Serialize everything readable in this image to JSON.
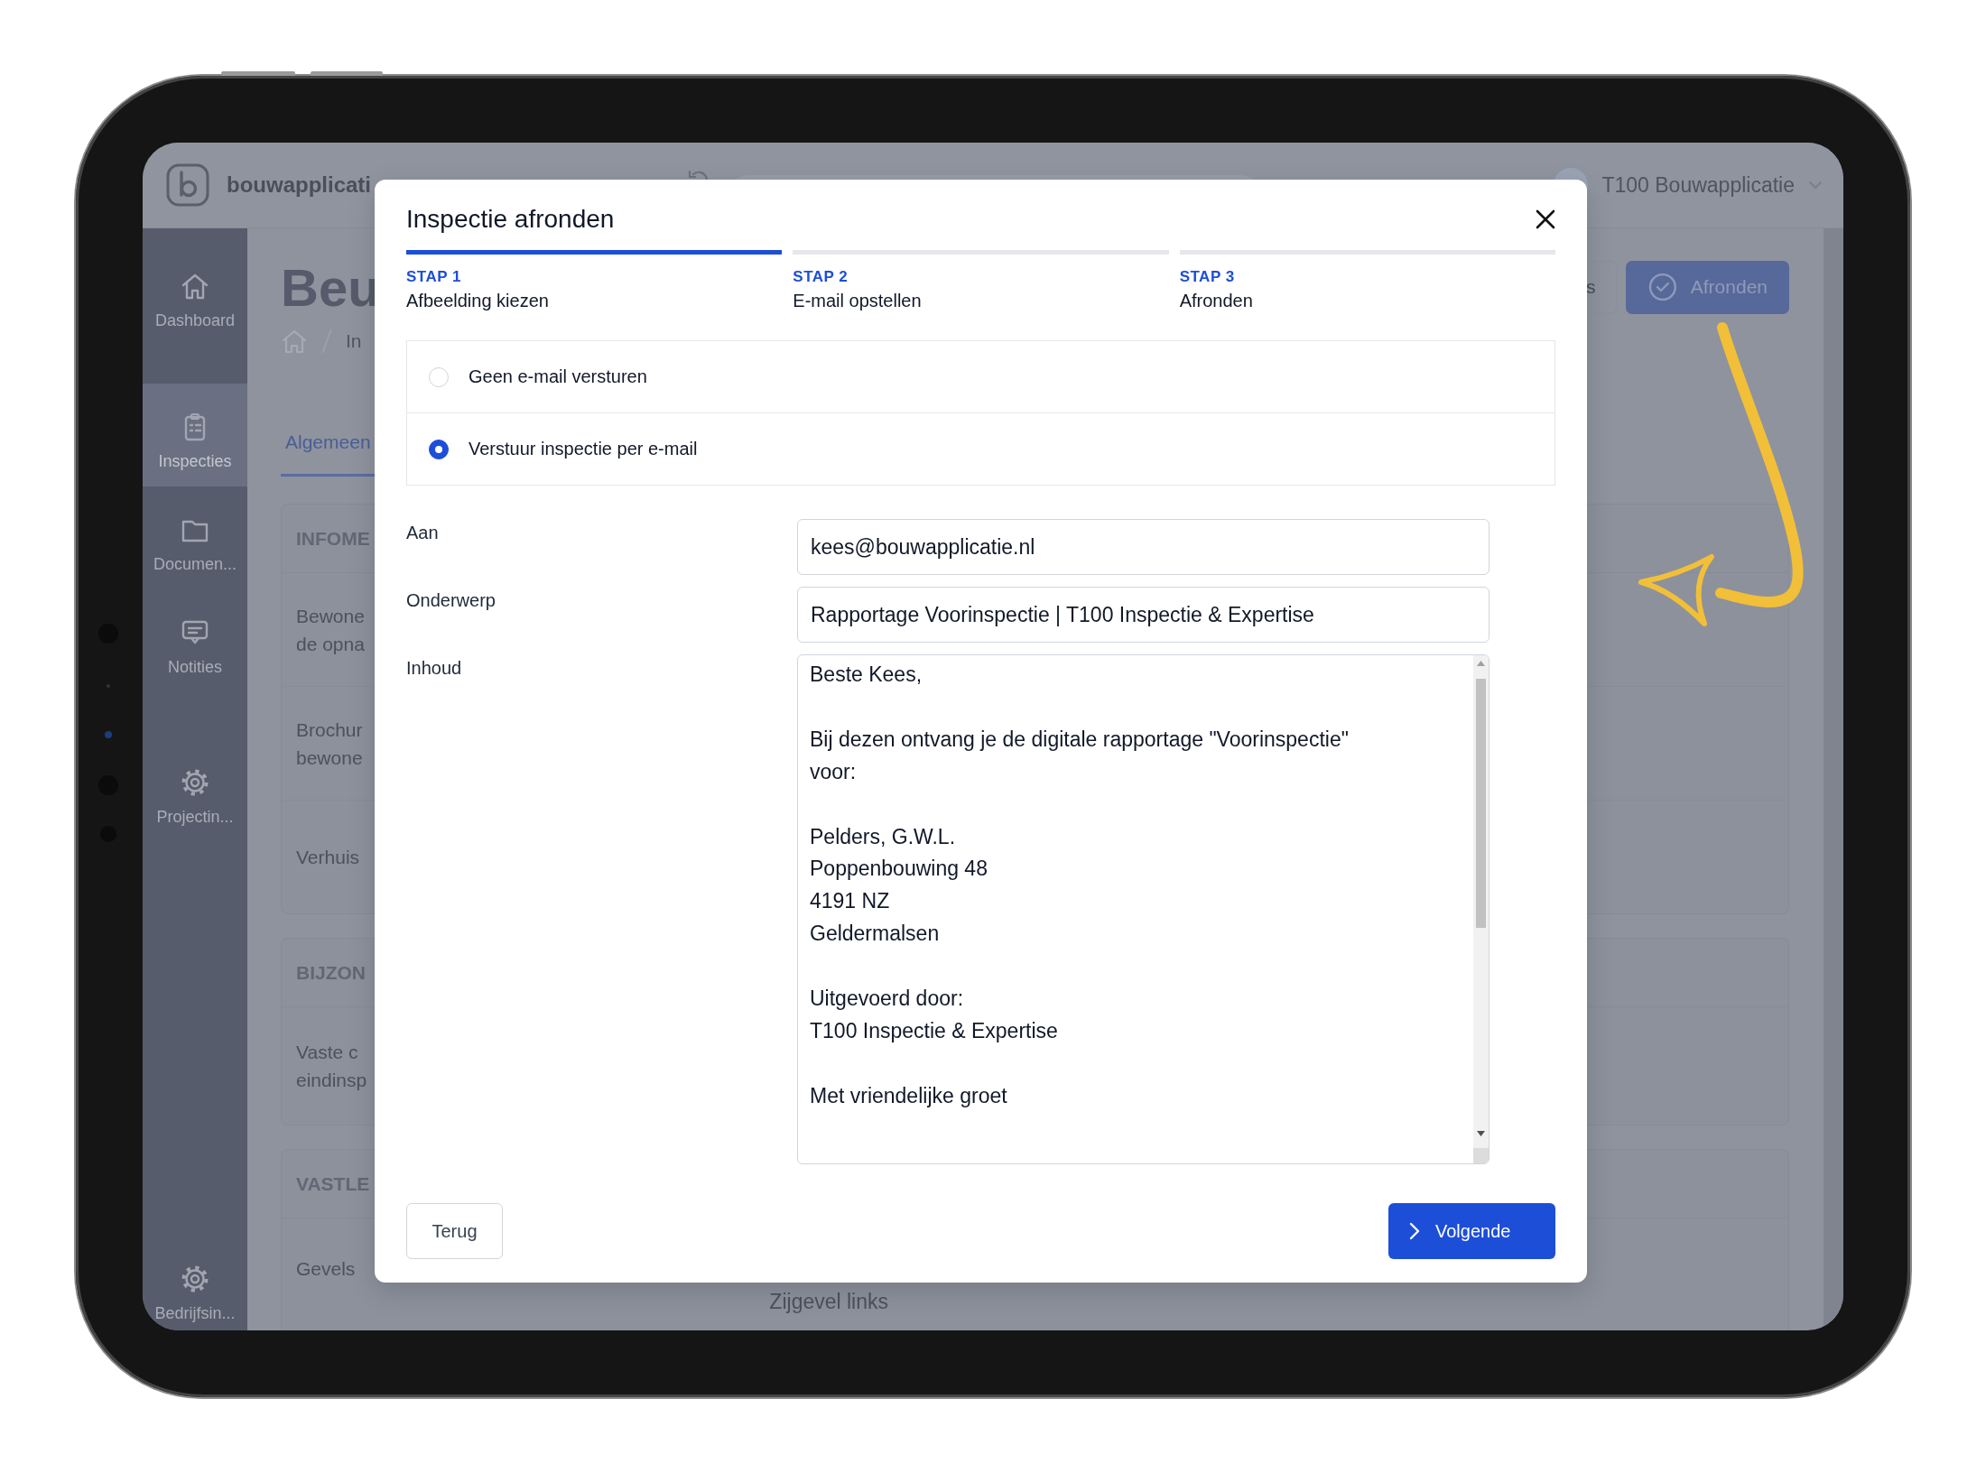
{
  "app": {
    "brand": "bouwapplicati",
    "account": "T100 Bouwapplicatie",
    "sidebar": [
      {
        "label": "Dashboard",
        "selected": false
      },
      {
        "label": "Inspecties",
        "selected": true
      },
      {
        "label": "Documen...",
        "selected": false
      },
      {
        "label": "Notities",
        "selected": false
      },
      {
        "label": "Projectin...",
        "selected": false
      }
    ],
    "sidebar_bottom": {
      "label": "Bedrijfsin..."
    },
    "page_title": "Beu",
    "breadcrumb": "In",
    "tab": "Algemeen",
    "header_buttons": [
      {
        "label": "s",
        "kind": "outline"
      },
      {
        "label": "Afronden",
        "kind": "primary"
      }
    ],
    "cards": [
      {
        "heading": "INFOME",
        "rows": [
          {
            "lines": [
              "Bewone",
              "de opna"
            ]
          },
          {
            "lines": [
              "Brochur",
              "bewone"
            ]
          },
          {
            "lines": [
              "Verhuis"
            ]
          }
        ]
      },
      {
        "heading": "BIJZON",
        "rows": [
          {
            "lines": [
              "Vaste c",
              "eindinsp"
            ]
          }
        ]
      },
      {
        "heading": "VASTLE",
        "rows": [
          {
            "lines": [
              "Gevels"
            ],
            "values": [
              "Zijgevel links"
            ]
          }
        ]
      }
    ]
  },
  "dialog": {
    "title": "Inspectie afronden",
    "steps": [
      {
        "label": "STAP 1",
        "title": "Afbeelding kiezen",
        "selected": true
      },
      {
        "label": "STAP 2",
        "title": "E-mail opstellen",
        "selected": false
      },
      {
        "label": "STAP 3",
        "title": "Afronden",
        "selected": false
      }
    ],
    "options": [
      {
        "label": "Geen e-mail versturen",
        "selected": false
      },
      {
        "label": "Verstuur inspectie per e-mail",
        "selected": true
      }
    ],
    "fields": [
      {
        "label": "Aan",
        "kind": "input",
        "value": "kees@bouwapplicatie.nl"
      },
      {
        "label": "Onderwerp",
        "kind": "input",
        "value": "Rapportage Voorinspectie | T100 Inspectie & Expertise"
      },
      {
        "label": "Inhoud",
        "kind": "textarea",
        "value": "Beste Kees,\n\nBij dezen ontvang je de digitale rapportage \"Voorinspectie\" voor:\n\nPelders, G.W.L.\nPoppenbouwing 48\n4191 NZ\nGeldermalsen\n\nUitgevoerd door:\nT100 Inspectie & Expertise\n\nMet vriendelijke groet"
      }
    ],
    "buttons": [
      {
        "label": "Terug",
        "kind": "secondary"
      },
      {
        "label": "Volgende",
        "kind": "primary"
      }
    ]
  }
}
